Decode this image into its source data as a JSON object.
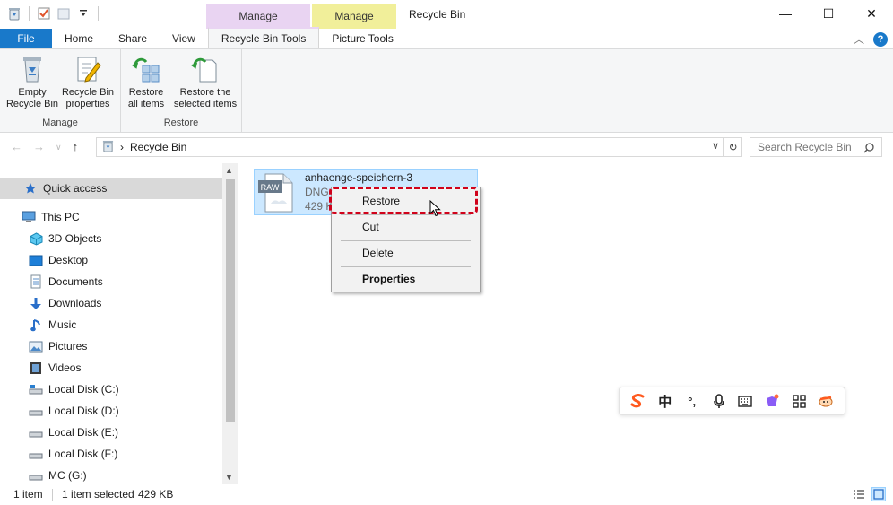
{
  "window": {
    "title": "Recycle Bin",
    "minimize": "—",
    "maximize": "☐",
    "close": "✕"
  },
  "context_groups": {
    "manage_recycle": "Manage",
    "manage_picture": "Manage"
  },
  "tabs": [
    {
      "label": "File"
    },
    {
      "label": "Home"
    },
    {
      "label": "Share"
    },
    {
      "label": "View"
    },
    {
      "label": "Recycle Bin Tools"
    },
    {
      "label": "Picture Tools"
    }
  ],
  "ribbon": {
    "manage_group": {
      "label": "Manage",
      "empty_bin": "Empty\nRecycle Bin",
      "empty_bin_line1": "Empty",
      "empty_bin_line2": "Recycle Bin",
      "properties_line1": "Recycle Bin",
      "properties_line2": "properties"
    },
    "restore_group": {
      "label": "Restore",
      "restore_all_line1": "Restore",
      "restore_all_line2": "all items",
      "restore_sel_line1": "Restore the",
      "restore_sel_line2": "selected items"
    }
  },
  "address": {
    "path": "Recycle Bin",
    "separator": "›",
    "search_placeholder": "Search Recycle Bin"
  },
  "sidebar": {
    "items": [
      {
        "label": "Quick access",
        "icon": "star-icon"
      },
      {
        "label": "This PC",
        "icon": "computer-icon"
      },
      {
        "label": "3D Objects",
        "icon": "cube-icon"
      },
      {
        "label": "Desktop",
        "icon": "desktop-icon"
      },
      {
        "label": "Documents",
        "icon": "documents-icon"
      },
      {
        "label": "Downloads",
        "icon": "download-icon"
      },
      {
        "label": "Music",
        "icon": "music-icon"
      },
      {
        "label": "Pictures",
        "icon": "pictures-icon"
      },
      {
        "label": "Videos",
        "icon": "videos-icon"
      },
      {
        "label": "Local Disk (C:)",
        "icon": "drive-icon"
      },
      {
        "label": "Local Disk (D:)",
        "icon": "drive-icon"
      },
      {
        "label": "Local Disk (E:)",
        "icon": "drive-icon"
      },
      {
        "label": "Local Disk (F:)",
        "icon": "drive-icon"
      },
      {
        "label": "MC (G:)",
        "icon": "drive-icon"
      }
    ]
  },
  "file": {
    "name": "anhaenge-speichern-3",
    "type": "DNG",
    "size": "429 K",
    "badge": "RAW"
  },
  "context_menu": {
    "items": [
      {
        "label": "Restore"
      },
      {
        "label": "Cut"
      },
      {
        "label": "Delete"
      },
      {
        "label": "Properties"
      }
    ]
  },
  "ime": {
    "chinese_char": "中",
    "punct": "°,"
  },
  "status": {
    "item_count": "1 item",
    "selected": "1 item selected",
    "size": "429 KB"
  },
  "colors": {
    "file_tab": "#1979ca",
    "manage_recycle": "#e9d4f2",
    "manage_picture": "#f1ef9a",
    "selection": "#cce8ff",
    "highlight_box": "#d0021b"
  }
}
